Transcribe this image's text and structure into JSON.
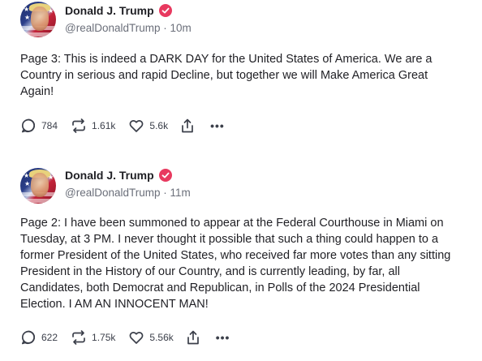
{
  "posts": [
    {
      "display_name": "Donald J. Trump",
      "handle": "@realDonaldTrump",
      "time": "10m",
      "text": "Page 3: This is indeed a DARK DAY for the United States of America. We are a Country in serious and rapid Decline, but together we will Make America Great Again!",
      "replies": "784",
      "retruths": "1.61k",
      "likes": "5.6k"
    },
    {
      "display_name": "Donald J. Trump",
      "handle": "@realDonaldTrump",
      "time": "11m",
      "text": "Page 2: I have been summoned to appear at the Federal Courthouse in Miami on Tuesday, at 3 PM. I never thought it possible that such a thing could happen to a former President of the United States, who received far more votes than any sitting President in the History of our Country, and is currently leading, by far, all Candidates, both Democrat and Republican, in Polls of the 2024 Presidential Election. I AM AN INNOCENT MAN!",
      "replies": "622",
      "retruths": "1.75k",
      "likes": "5.56k"
    }
  ],
  "separator": "·",
  "more_label": "•••",
  "colors": {
    "verified_badge": "#e8395f",
    "text": "#1f1f24",
    "muted": "#6b6f7a",
    "icon": "#3b3f4a"
  },
  "icons": [
    "verified-badge-icon",
    "reply-icon",
    "retruth-icon",
    "like-icon",
    "share-icon",
    "more-icon"
  ]
}
